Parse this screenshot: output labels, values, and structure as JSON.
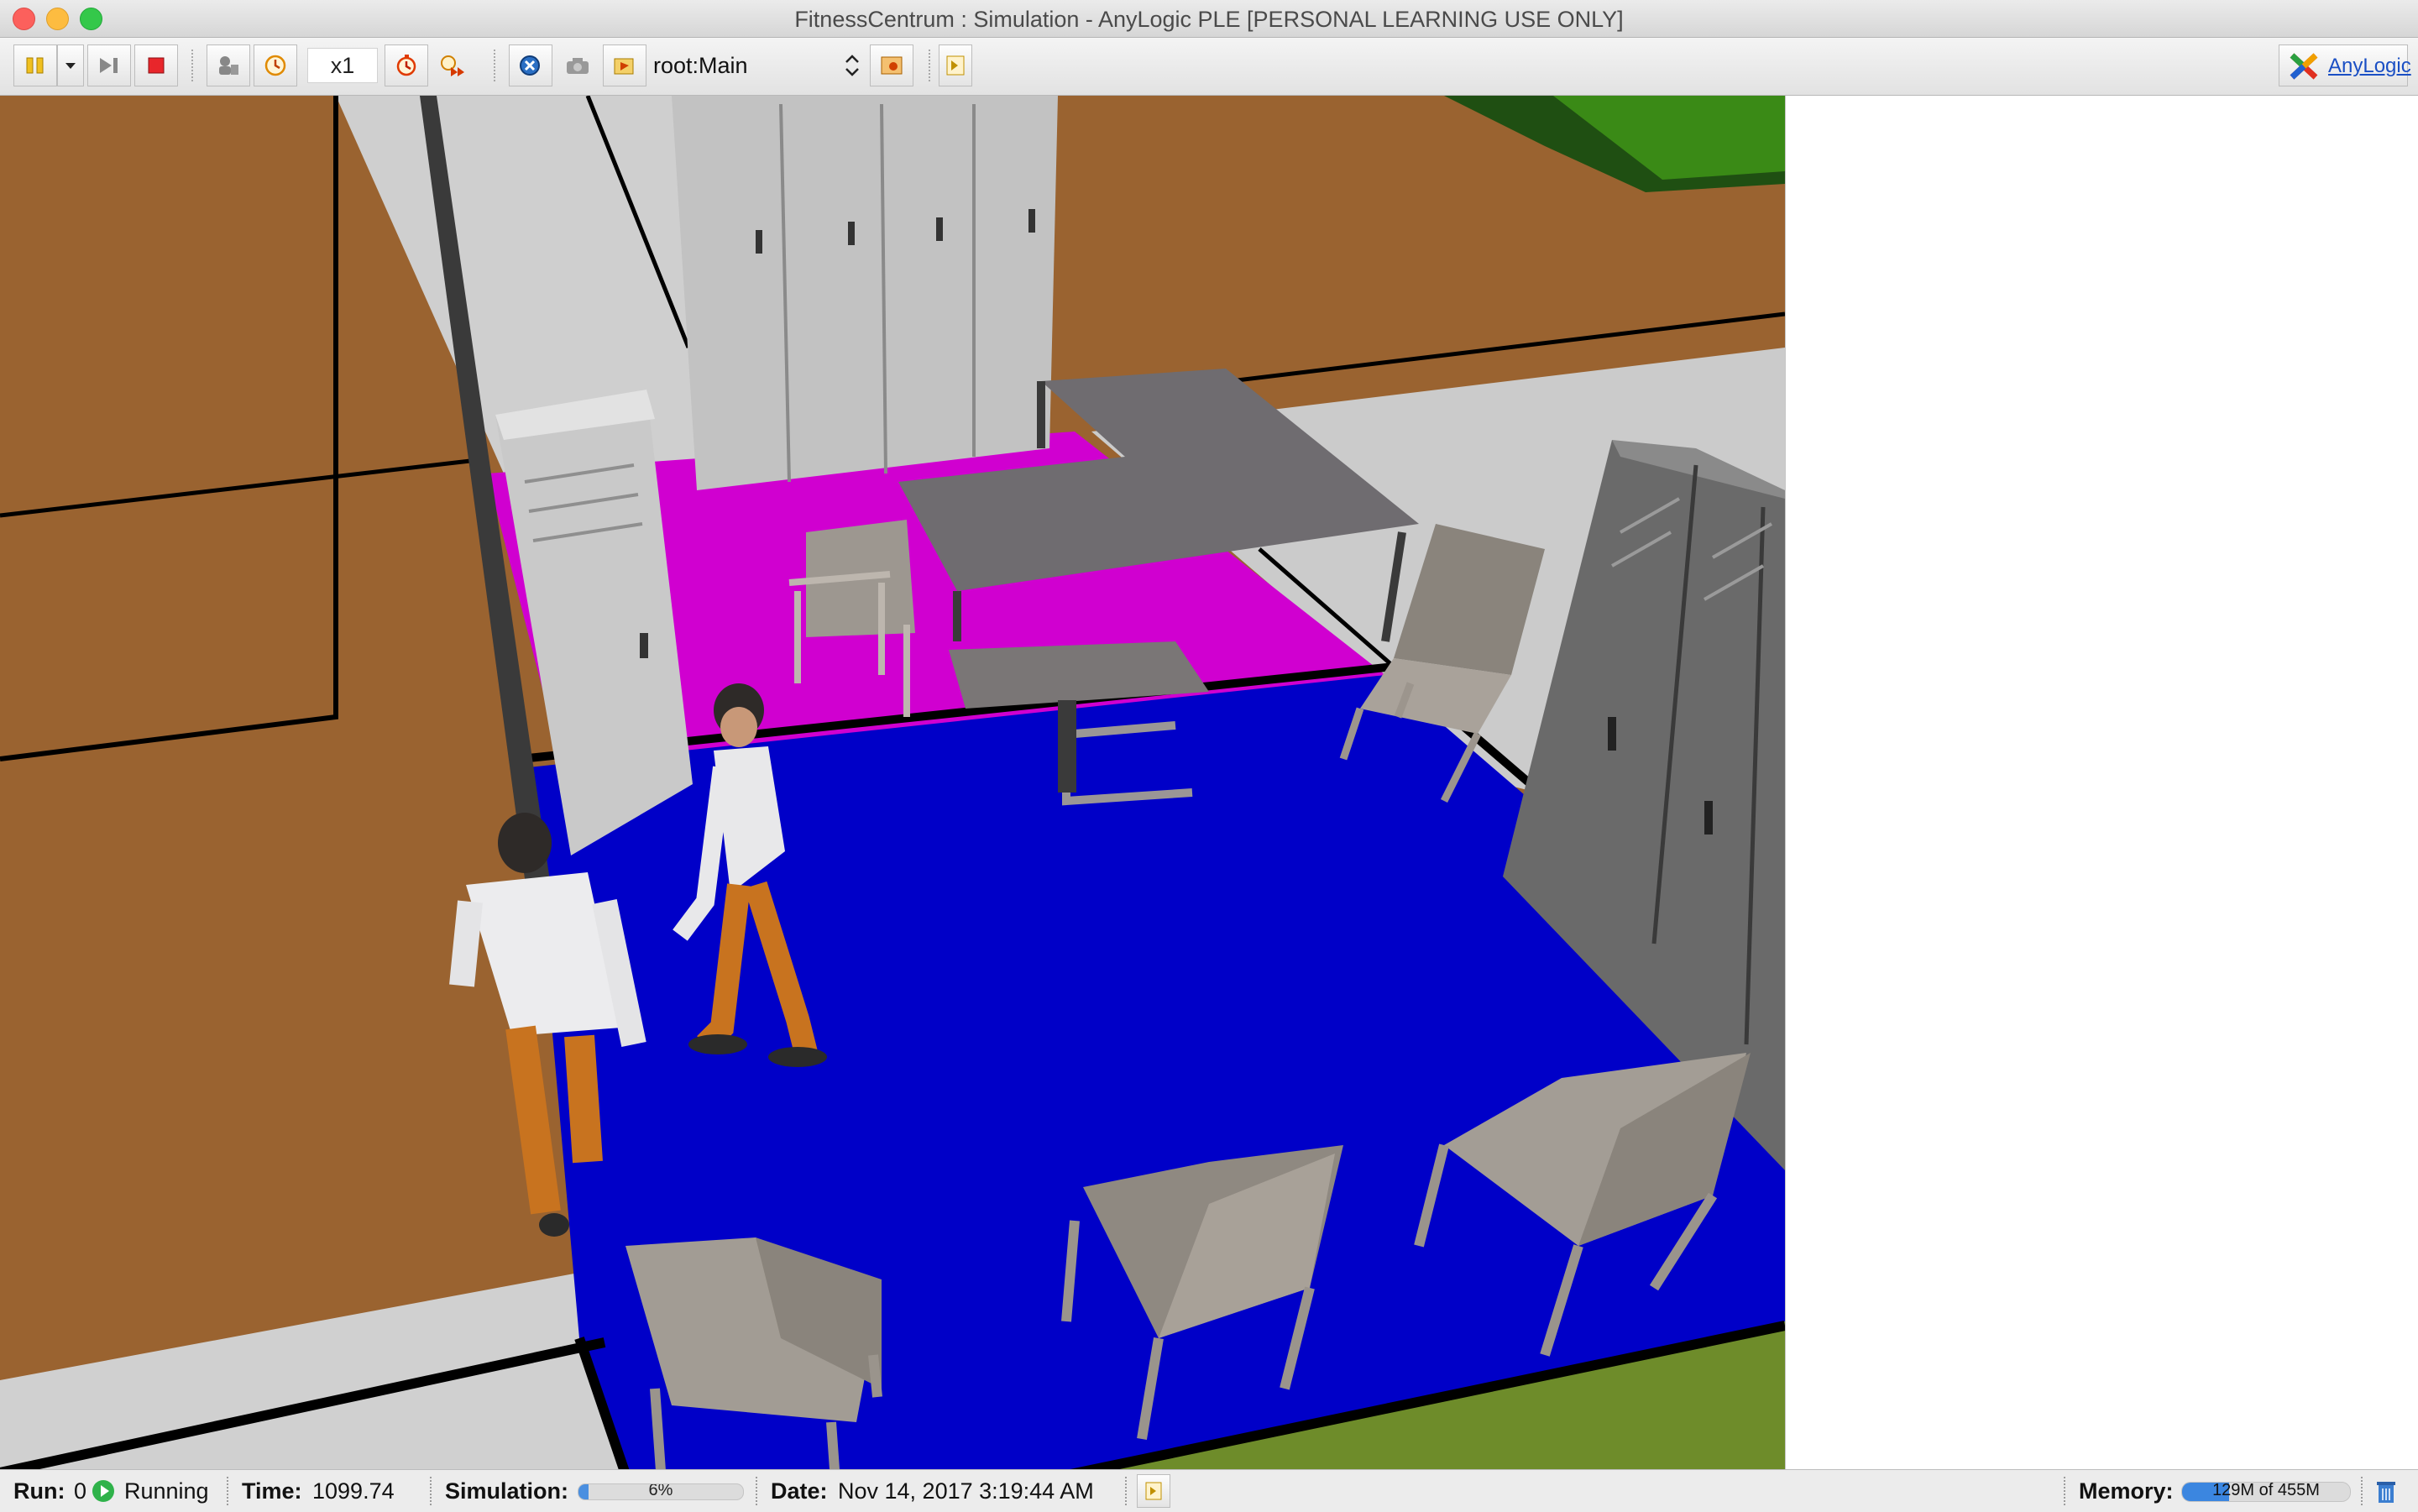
{
  "window": {
    "title": "FitnessCentrum : Simulation - AnyLogic PLE [PERSONAL LEARNING USE ONLY]"
  },
  "toolbar": {
    "speed": "x1",
    "root_selector": "root:Main",
    "brand_label": "AnyLogic",
    "buttons": [
      "pause-icon",
      "dropdown-arrow-icon",
      "step-icon",
      "stop-icon",
      "agent-icon",
      "clock-icon",
      "speed-up-icon",
      "run-fast-icon",
      "experiment-icon",
      "camera-icon",
      "navigate-icon",
      "view-area-icon",
      "console-icon"
    ]
  },
  "status": {
    "run_label": "Run:",
    "run_value": "0",
    "run_state": "Running",
    "time_label": "Time:",
    "time_value": "1099.74",
    "simulation_label": "Simulation:",
    "simulation_percent": "6%",
    "simulation_fraction": 0.06,
    "date_label": "Date:",
    "date_value": "Nov 14, 2017 3:19:44 AM",
    "memory_label": "Memory:",
    "memory_value": "129M of 455M",
    "memory_fraction": 0.28
  },
  "colors": {
    "floor_blue": "#0000c8",
    "floor_magenta": "#d000d0",
    "floor_wood": "#9a6330",
    "locker_gray": "#c4c4c4",
    "grass_green": "#6e8c2a"
  }
}
